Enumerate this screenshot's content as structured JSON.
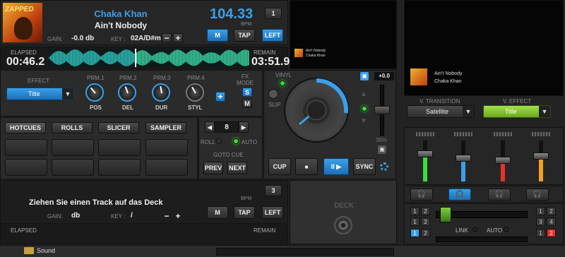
{
  "deck1": {
    "cover_text": "ZAPPED",
    "artist": "Chaka Khan",
    "title": "Ain't Nobody",
    "bpm": "104.33",
    "bpm_label": "BPM",
    "deck_number": "1",
    "gain_label": "GAIN:",
    "gain_value": "-0.0 db",
    "key_label": "KEY :",
    "key_value": "02A/D#m",
    "key_minus": "−",
    "key_plus": "+",
    "m_label": "M",
    "tap_label": "TAP",
    "left_label": "LEFT",
    "elapsed_label": "ELAPSED",
    "elapsed": "00:46.2",
    "remain_label": "REMAIN",
    "remain": "03:51.9",
    "progress": 0.19
  },
  "effects": {
    "effect_label": "EFFECT",
    "effect_value": "Title",
    "params": [
      {
        "header": "PRM.1",
        "label": "POS"
      },
      {
        "header": "PRM.2",
        "label": "DEL"
      },
      {
        "header": "PRM.3",
        "label": "DUR"
      },
      {
        "header": "PRM.4",
        "label": "STYL"
      }
    ],
    "add_label": "+",
    "fx_mode_label": "FX MODE",
    "fx_s": "S",
    "fx_m": "M"
  },
  "pads": {
    "tabs": [
      "HOTCUES",
      "ROLLS",
      "SLICER",
      "SAMPLER"
    ],
    "loop_value": "8",
    "loop_prev": "◀",
    "loop_next": "▶",
    "roll_label": "ROLL",
    "auto_label": "AUTO",
    "goto_cue_label": "GOTO CUE",
    "prev_label": "PREV",
    "next_label": "NEXT"
  },
  "jog": {
    "vinyl_label": "VINYL",
    "slip_label": "SLIP",
    "pitch_value": "+0.0",
    "pitch_percent": "36%",
    "cup_label": "CUP",
    "stop_label": "■",
    "play_label": "II ▶",
    "sync_label": "SYNC"
  },
  "deck2": {
    "prompt": "Ziehen Sie einen Track auf das Deck",
    "bpm_label": "BPM",
    "deck_number": "3",
    "gain_label": "GAIN:",
    "gain_value": "db",
    "key_label": "KEY :",
    "key_value": "/",
    "key_minus": "−",
    "key_plus": "+",
    "m_label": "M",
    "tap_label": "TAP",
    "left_label": "LEFT",
    "elapsed_label": "ELAPSED",
    "remain_label": "REMAIN",
    "deck_label": "DECK"
  },
  "preview": {
    "mini_title": "Ain't Nobody",
    "mini_artist": "Chaka Khan"
  },
  "video": {
    "track_title": "Ain't Nobody",
    "track_artist": "Chaka Khan",
    "transition_label": "V. TRANSITION",
    "transition_value": "Satellite",
    "effect_label": "V. EFFECT",
    "effect_value": "Title"
  },
  "mixer": {
    "levels": [
      0.65,
      0.55,
      0.5,
      0.6
    ],
    "level_colors": [
      "#3cdc3c",
      "#3aa0e8",
      "#e8302a",
      "#f2a020"
    ],
    "deck_chips_left": [
      "1",
      "2",
      "3",
      "4"
    ],
    "deck_chips_right": [
      "1",
      "2",
      "3",
      "4"
    ],
    "link_label": "LINK",
    "auto_label": "AUTO"
  },
  "bottom_bar": {
    "label": "Sound"
  },
  "colors": {
    "accent": "#3aa0e8",
    "green": "#8fd436"
  }
}
